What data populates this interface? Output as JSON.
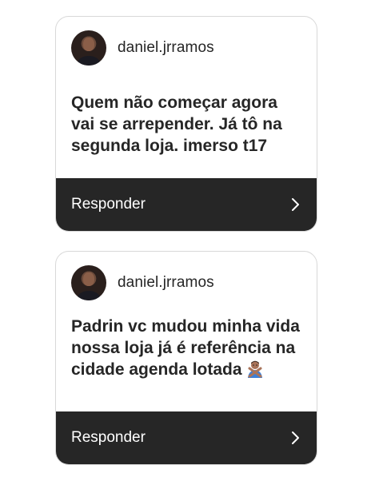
{
  "cards": [
    {
      "username": "daniel.jrramos",
      "message": "Quem não começar agora vai se arrepender. Já tô na segunda loja. imerso t17",
      "reply_label": "Responder"
    },
    {
      "username": "daniel.jrramos",
      "message": "Padrin vc mudou minha vida nossa loja já é referência na cidade agenda lotada",
      "emoji": "person-gesturing-no-emoji",
      "reply_label": "Responder"
    }
  ],
  "colors": {
    "reply_bar": "#262626",
    "text": "#262626",
    "card_border": "#d8d8d8"
  }
}
